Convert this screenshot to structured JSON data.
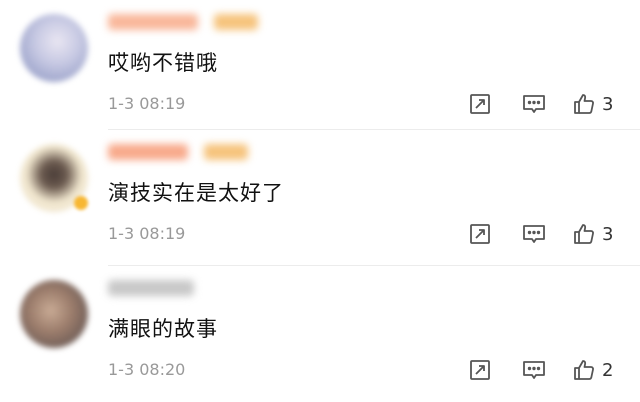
{
  "comments": [
    {
      "avatar_color": "#b7bedb",
      "name_color": "#f9b79a",
      "tag_color": "#f6c37b",
      "text": "哎哟不错哦",
      "time": "1-3 08:19",
      "likes": "3",
      "icons": [
        "share-icon",
        "comment-icon",
        "thumbs-up-icon"
      ]
    },
    {
      "avatar_color": "#e8d7b7",
      "name_color": "#f8a98a",
      "tag_color": "#f6c37b",
      "text": "演技实在是太好了",
      "time": "1-3 08:19",
      "likes": "3",
      "icons": [
        "share-icon",
        "comment-icon",
        "thumbs-up-icon"
      ]
    },
    {
      "avatar_color": "#a58a7a",
      "name_color": "#c8c8c8",
      "text": "满眼的故事",
      "time": "1-3 08:20",
      "likes": "2",
      "icons": [
        "share-icon",
        "comment-icon",
        "thumbs-up-icon"
      ]
    }
  ]
}
